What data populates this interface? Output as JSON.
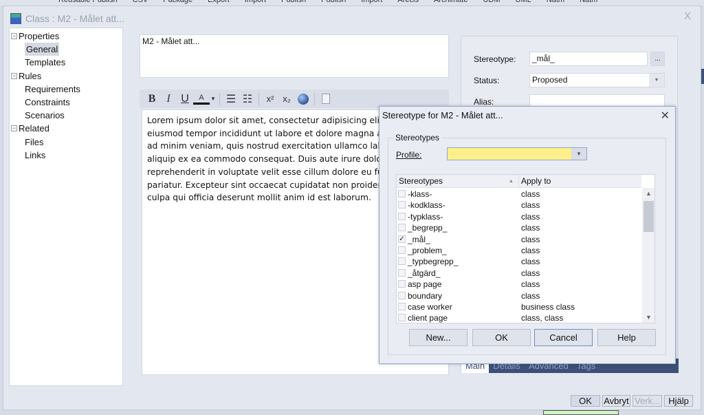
{
  "app_menu": [
    "Reusable Publish",
    "CSV",
    "Package",
    "Export",
    "Import",
    "Publish",
    "Publish",
    "Import",
    "Arecis",
    "Archimate",
    "UDM",
    "UML",
    "Nätm",
    "Nätm"
  ],
  "window": {
    "title": "Class : M2 - Målet att...",
    "close": "X"
  },
  "tree": {
    "items": [
      {
        "label": "Properties",
        "level": 0,
        "expander": "−"
      },
      {
        "label": "General",
        "level": 1,
        "selected": true
      },
      {
        "label": "Templates",
        "level": 1
      },
      {
        "label": "Rules",
        "level": 0,
        "expander": "−"
      },
      {
        "label": "Requirements",
        "level": 1
      },
      {
        "label": "Constraints",
        "level": 1
      },
      {
        "label": "Scenarios",
        "level": 1
      },
      {
        "label": "Related",
        "level": 0,
        "expander": "−"
      },
      {
        "label": "Files",
        "level": 1
      },
      {
        "label": "Links",
        "level": 1
      }
    ]
  },
  "name_value": "M2 - Målet att...",
  "toolbar": {
    "bold": "B",
    "italic": "I",
    "underline": "U"
  },
  "editor_lines": [
    "Lorem ipsum dolor sit amet, consectetur adipisicing elit",
    "eiusmod tempor incididunt ut labore et dolore magna a",
    "ad minim veniam, quis nostrud exercitation ullamco lab",
    "aliquip ex ea commodo consequat. Duis aute irure dolo",
    "reprehenderit in voluptate velit esse cillum dolore eu fu",
    "pariatur. Excepteur sint occaecat cupidatat non proiden",
    "culpa qui officia deserunt mollit anim id est laborum."
  ],
  "props": {
    "stereotype_label": "Stereotype:",
    "stereotype_value": "_mål_",
    "browse": "...",
    "status_label": "Status:",
    "status_value": "Proposed",
    "alias_label": "Alias:",
    "alias_value": ""
  },
  "tabs": [
    "Main",
    "Details",
    "Advanced",
    "Tags"
  ],
  "window_buttons": {
    "ok": "OK",
    "cancel": "Avbryt",
    "apply": "Verk...",
    "help": "Hjälp"
  },
  "dialog": {
    "title": "Stereotype for M2 - Målet att...",
    "close": "✕",
    "group": "Stereotypes",
    "profile_label": "Profile:",
    "profile_value": "",
    "profile_color": "#fdf08a",
    "columns": [
      "Stereotypes",
      "Apply to"
    ],
    "rows": [
      {
        "name": "-klass-",
        "apply": "class",
        "checked": false
      },
      {
        "name": "-kodklass-",
        "apply": "class",
        "checked": false
      },
      {
        "name": "-typklass-",
        "apply": "class",
        "checked": false
      },
      {
        "name": "_begrepp_",
        "apply": "class",
        "checked": false
      },
      {
        "name": "_mål_",
        "apply": "class",
        "checked": true
      },
      {
        "name": "_problem_",
        "apply": "class",
        "checked": false
      },
      {
        "name": "_typbegrepp_",
        "apply": "class",
        "checked": false
      },
      {
        "name": "_åtgärd_",
        "apply": "class",
        "checked": false
      },
      {
        "name": "asp page",
        "apply": "class",
        "checked": false
      },
      {
        "name": "boundary",
        "apply": "class",
        "checked": false
      },
      {
        "name": "case worker",
        "apply": "business class",
        "checked": false
      },
      {
        "name": "client page",
        "apply": "class, class",
        "checked": false
      }
    ],
    "buttons": {
      "new": "New...",
      "ok": "OK",
      "cancel": "Cancel",
      "help": "Help"
    }
  }
}
